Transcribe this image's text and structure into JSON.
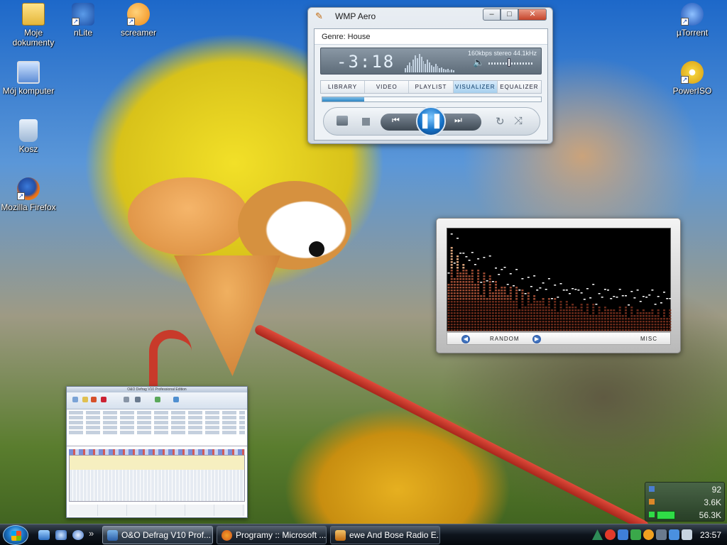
{
  "desktop": {
    "icons": [
      {
        "id": "moje-dokumenty",
        "label": "Moje dokumenty",
        "icon": "folder-icon"
      },
      {
        "id": "nlite",
        "label": "nLite",
        "icon": "nlite-icon"
      },
      {
        "id": "screamer",
        "label": "screamer",
        "icon": "screamer-icon"
      },
      {
        "id": "moj-komputer",
        "label": "Mój komputer",
        "icon": "computer-icon"
      },
      {
        "id": "kosz",
        "label": "Kosz",
        "icon": "recycle-bin-icon"
      },
      {
        "id": "firefox",
        "label": "Mozilla Firefox",
        "icon": "firefox-icon"
      },
      {
        "id": "utorrent",
        "label": "µTorrent",
        "icon": "utorrent-icon"
      },
      {
        "id": "poweriso",
        "label": "PowerISO",
        "icon": "poweriso-icon"
      }
    ]
  },
  "wmp": {
    "title": "WMP Aero",
    "genre": "Genre: House",
    "time": "-3:18",
    "bitrate": "160kbps stereo 44.1kHz",
    "tabs": [
      {
        "label": "LIBRARY",
        "active": false
      },
      {
        "label": "VIDEO",
        "active": false
      },
      {
        "label": "PLAYLIST",
        "active": false
      },
      {
        "label": "VISUALIZER",
        "active": true
      },
      {
        "label": "EQUALIZER",
        "active": false
      }
    ],
    "progress": 0.19,
    "volume": 0.45,
    "window_buttons": {
      "minimize": "–",
      "maximize": "□",
      "close": "✕"
    },
    "controls": {
      "prev": "⏮",
      "play_pause": "❚❚",
      "next": "⏭",
      "repeat": "↻",
      "shuffle": "⤨"
    }
  },
  "visualizer": {
    "random_label": "RANDOM",
    "misc_label": "MISC",
    "prev_arrow": "◀",
    "next_arrow": "▶"
  },
  "thumbnail": {
    "title": "O&O Defrag V10 Professional Edition"
  },
  "meter": {
    "rows": [
      {
        "value": "92"
      },
      {
        "value": "3.6K"
      },
      {
        "value": "56.3K"
      }
    ]
  },
  "taskbar": {
    "tasks": [
      {
        "label": "O&O Defrag V10 Prof...",
        "active": true,
        "icon": "defrag-icon"
      },
      {
        "label": "Programy :: Microsoft ...",
        "active": false,
        "icon": "firefox-icon"
      },
      {
        "label": "ewe And Bose Radio E...",
        "active": false,
        "icon": "wmp-icon"
      }
    ],
    "clock": "23:57",
    "colors": {
      "accent": "#1b76c9"
    }
  }
}
